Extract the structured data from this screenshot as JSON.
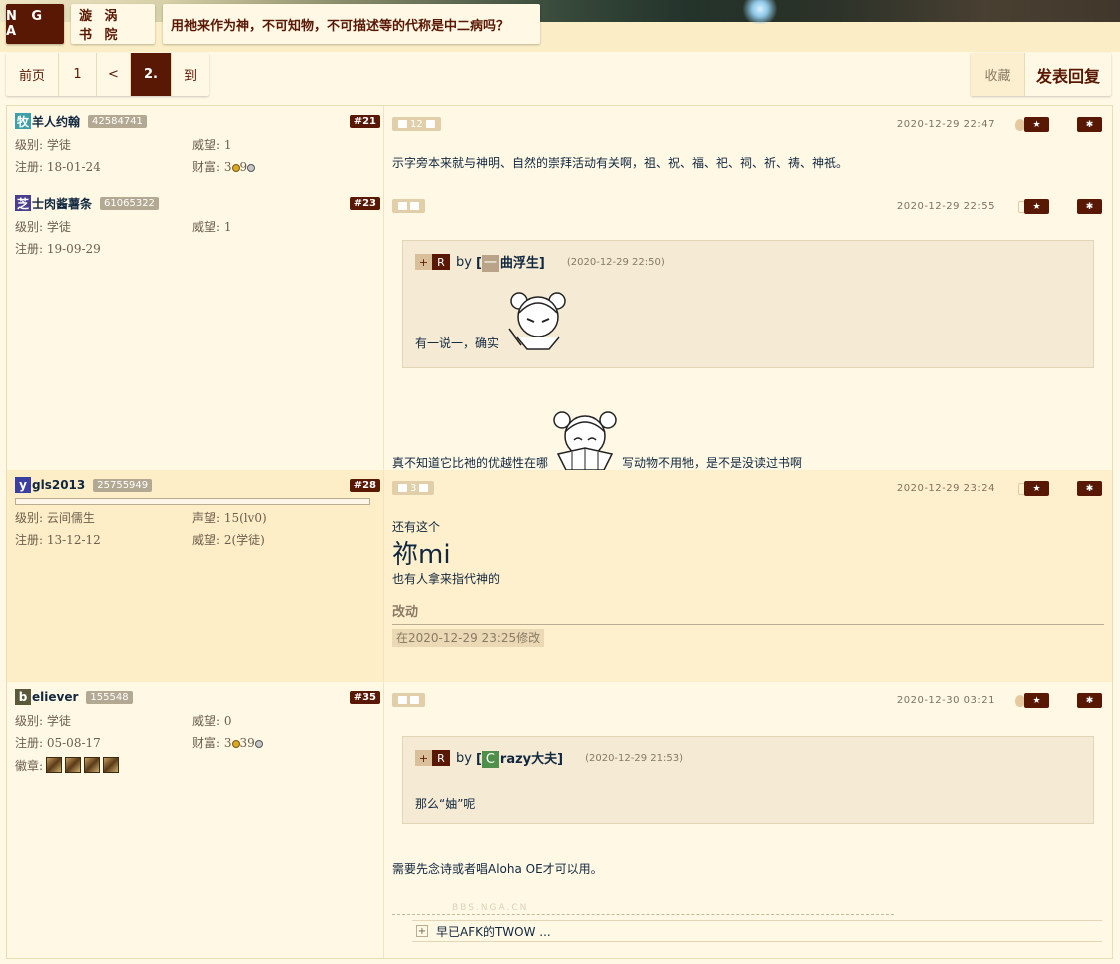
{
  "header": {
    "logo": "N G A",
    "forum": "漩 涡 书 院",
    "topic": "用祂来作为神，不可知物，不可描述等的代称是中二病吗？"
  },
  "pager": {
    "front": "前页",
    "page1": "1",
    "prev": "<",
    "current": "2.",
    "goto": "到"
  },
  "actions": {
    "favorite": "收藏",
    "reply": "发表回复"
  },
  "colors": {
    "brand": "#591804",
    "text": "#10273f",
    "bg": "#fff8e5",
    "alt_bg": "#fff0cd"
  },
  "posts": [
    {
      "avatar_char": "牧",
      "avatar_color": "#3f9fa8",
      "username": "羊人约翰",
      "uid": "42584741",
      "floor": "#21",
      "level_label": "级别: 学徒",
      "prestige_label": "威望: 1",
      "reg_label": "注册: 18-01-24",
      "wealth_label": "财富: 3",
      "wealth_tail": "9",
      "votes": "12",
      "time": "2020-12-29 22:47",
      "device": "apple-icon",
      "content": "示字旁本来就与神明、自然的崇拜活动有关啊，祖、祝、福、祀、祠、祈、祷、神祇。"
    },
    {
      "avatar_char": "芝",
      "avatar_color": "#4a3f8f",
      "username": "士肉酱薯条",
      "uid": "61065322",
      "floor": "#23",
      "level_label": "级别: 学徒",
      "prestige_label": "威望: 1",
      "reg_label": "注册: 19-09-29",
      "votes": "",
      "time": "2020-12-29 22:55",
      "device": "phone-icon",
      "quote": {
        "plus": "+",
        "r": "R",
        "by": "by",
        "name_char": "一",
        "name_rest": "曲浮生]",
        "name_open": "[",
        "time": "(2020-12-29 22:50)",
        "body": "有一说一，确实"
      },
      "content_before": "真不知道它比祂的优越性在哪",
      "content_after": "写动物不用牠，是不是没读过书啊"
    },
    {
      "avatar_char": "y",
      "avatar_color": "#3b3fa0",
      "username": "gls2013",
      "uid": "25755949",
      "floor": "#28",
      "level_label": "级别: 云间儒生",
      "reputation_label": "声望: 15(lv0)",
      "reg_label": "注册: 13-12-12",
      "prestige_label": "威望: 2(学徒)",
      "votes": "3",
      "time": "2020-12-29 23:24",
      "device": "phone-icon",
      "line1": "还有这个",
      "big": "祢mi",
      "line2": "也有人拿来指代神的",
      "edit_title": "改动",
      "edit_note": "在2020-12-29 23:25修改"
    },
    {
      "avatar_char": "b",
      "avatar_color": "#5a5a3a",
      "username": "eliever",
      "uid": "155548",
      "floor": "#35",
      "level_label": "级别: 学徒",
      "prestige_label": "威望: 0",
      "reg_label": "注册: 05-08-17",
      "wealth_label": "财富: 3",
      "wealth_tail": "39",
      "badges_label": "徽章:",
      "votes": "",
      "time": "2020-12-30 03:21",
      "device": "apple-icon",
      "quote": {
        "plus": "+",
        "r": "R",
        "by": "by",
        "name_char": "C",
        "name_rest": "razy大夫]",
        "name_open": "[",
        "time": "(2020-12-29 21:53)",
        "body": "那么“妯”呢"
      },
      "content": "需要先念诗或者唱Aloha OE才可以用。",
      "watermark": "BBS.NGA.CN",
      "signature": "早已AFK的TWOW ..."
    }
  ]
}
